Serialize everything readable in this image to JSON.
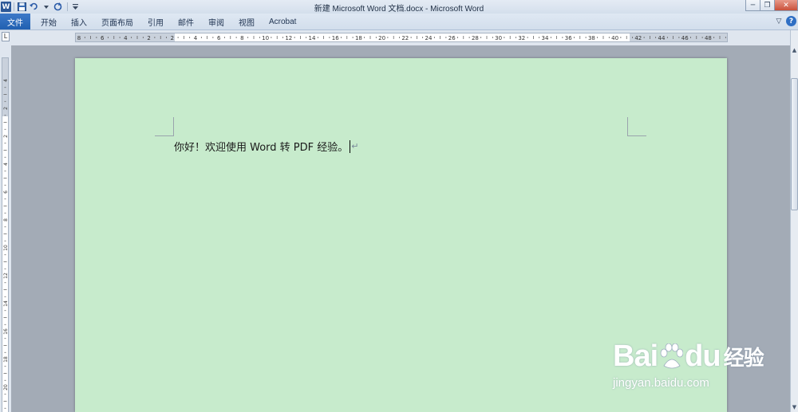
{
  "window": {
    "title": "新建 Microsoft Word 文档.docx - Microsoft Word",
    "app_icon_letter": "W",
    "controls": {
      "minimize": "─",
      "restore": "❐",
      "close": "✕"
    }
  },
  "quick_access": {
    "save_icon": "save-icon",
    "undo_icon": "undo-icon",
    "redo_icon": "redo-icon",
    "customize_icon": "customize-icon"
  },
  "ribbon": {
    "file_tab": "文件",
    "tabs": [
      "开始",
      "插入",
      "页面布局",
      "引用",
      "邮件",
      "审阅",
      "视图",
      "Acrobat"
    ],
    "help": "?",
    "minimize_ribbon": "▽"
  },
  "ruler": {
    "tab_selector": "L",
    "ticks": [
      "8",
      "6",
      "4",
      "2",
      "2",
      "4",
      "6",
      "8",
      "10",
      "12",
      "14",
      "16",
      "18",
      "20",
      "22",
      "24",
      "26",
      "28",
      "30",
      "32",
      "34",
      "36",
      "38",
      "40",
      "42",
      "44",
      "46",
      "48"
    ],
    "vertical_ticks": [
      "4",
      "2",
      "2",
      "4",
      "6",
      "8",
      "10",
      "12",
      "14",
      "16",
      "18",
      "20"
    ]
  },
  "document": {
    "text": "你好！欢迎使用 Word 转 PDF 经验。",
    "paragraph_mark": "↵",
    "page_color": "#c7ebcc"
  },
  "watermark": {
    "brand_left": "Bai",
    "brand_right": "du",
    "brand_cn": "经验",
    "url": "jingyan.baidu.com"
  }
}
